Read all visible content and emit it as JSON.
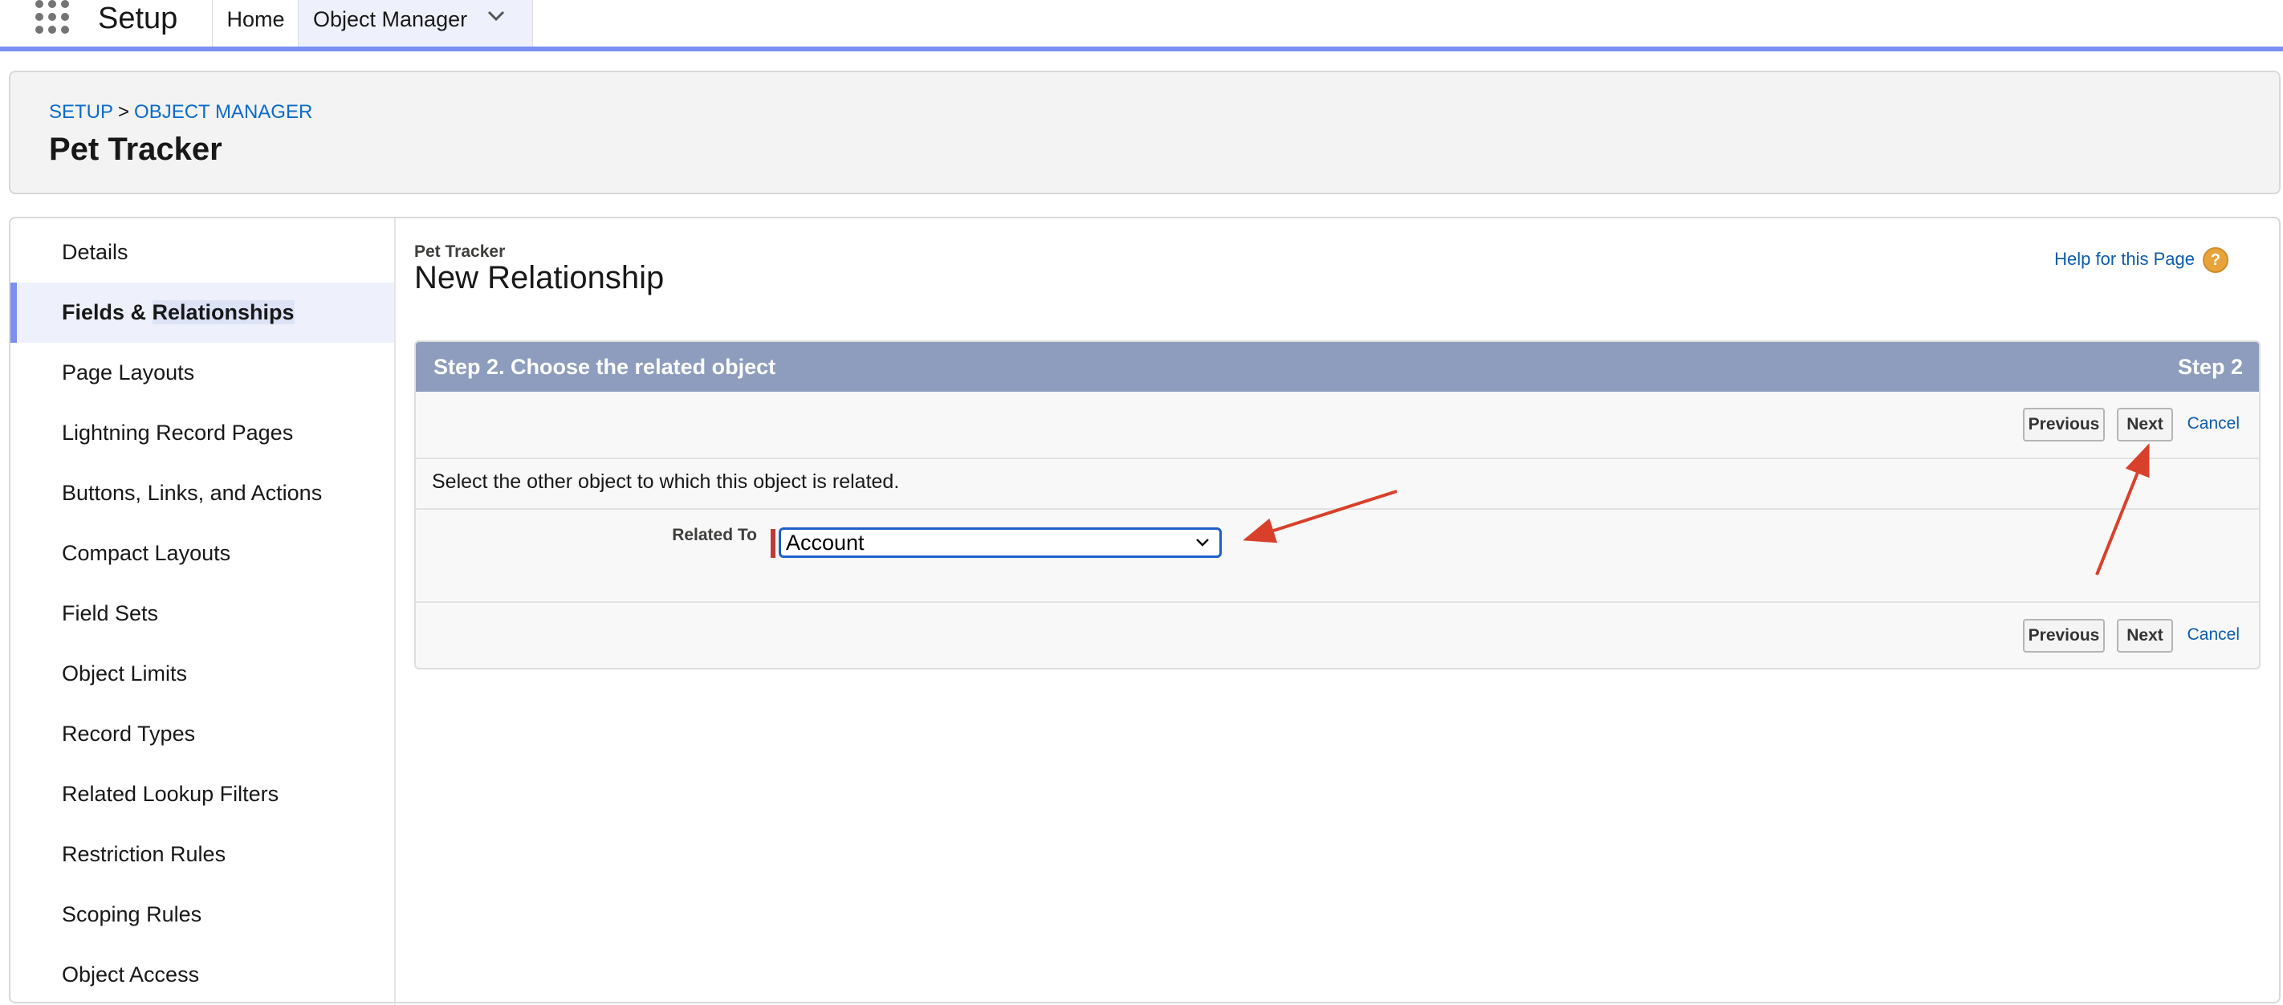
{
  "topbar": {
    "app_name": "Setup",
    "tabs": [
      {
        "label": "Home"
      },
      {
        "label": "Object Manager"
      }
    ]
  },
  "header": {
    "breadcrumb": [
      "SETUP",
      "OBJECT MANAGER"
    ],
    "breadcrumb_separator": ">",
    "title": "Pet Tracker"
  },
  "sidebar": {
    "items": [
      {
        "label": "Details"
      },
      {
        "label_before": "Fields & ",
        "label_highlight": "Relationships",
        "active": true
      },
      {
        "label": "Page Layouts"
      },
      {
        "label": "Lightning Record Pages"
      },
      {
        "label": "Buttons, Links, and Actions"
      },
      {
        "label": "Compact Layouts"
      },
      {
        "label": "Field Sets"
      },
      {
        "label": "Object Limits"
      },
      {
        "label": "Record Types"
      },
      {
        "label": "Related Lookup Filters"
      },
      {
        "label": "Restriction Rules"
      },
      {
        "label": "Scoping Rules"
      },
      {
        "label": "Object Access"
      }
    ]
  },
  "content": {
    "object_label": "Pet Tracker",
    "page_title": "New Relationship",
    "help_link": "Help for this Page",
    "help_icon": "?",
    "step": {
      "title": "Step 2. Choose the related object",
      "indicator": "Step 2",
      "buttons": {
        "previous": "Previous",
        "next": "Next",
        "cancel": "Cancel"
      },
      "instructions": "Select the other object to which this object is related.",
      "field": {
        "label": "Related To",
        "selected_value": "Account"
      }
    }
  },
  "colors": {
    "accent": "#7b8ff0",
    "link": "#0b5cab",
    "step_header": "#8e9dbd",
    "required": "#c23934",
    "annotation_arrow": "#d9402b"
  }
}
